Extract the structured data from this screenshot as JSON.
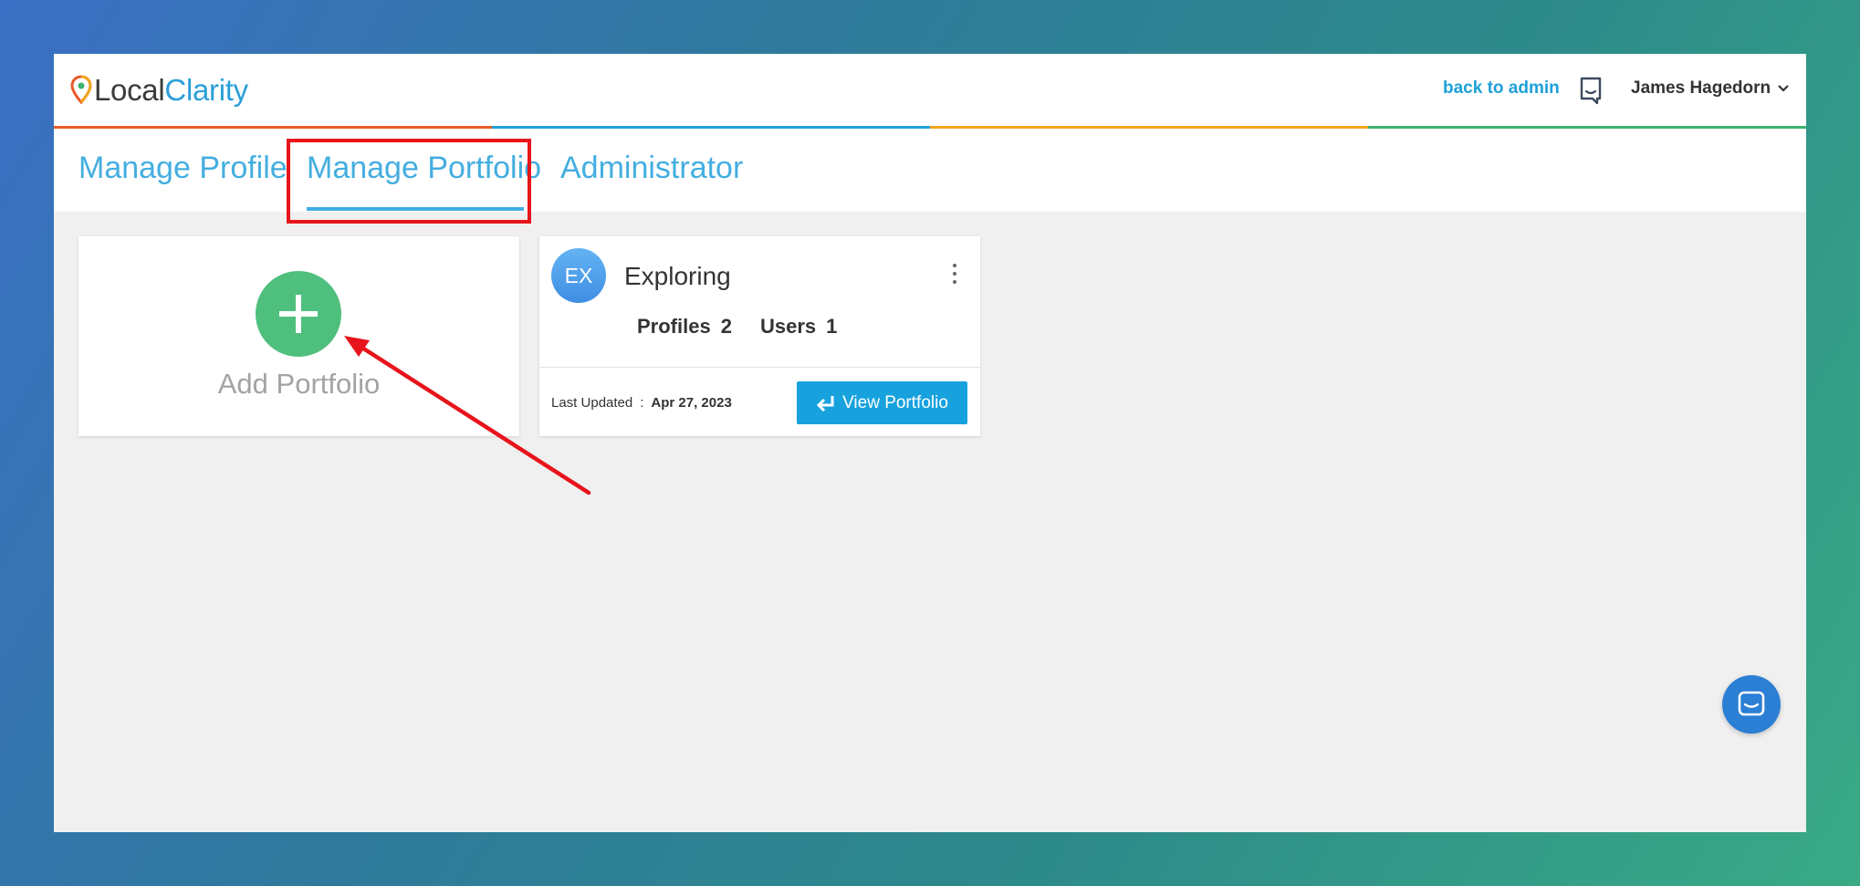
{
  "brand": {
    "name_part1": "Local",
    "name_part2": "Clarity",
    "colors": {
      "dark": "#3a3a3a",
      "accent": "#2b9fd8",
      "orange": "#ea5a2b",
      "blue": "#1ea1d9",
      "yellow": "#f2a51f",
      "green": "#3cb46d"
    }
  },
  "header": {
    "back_to_admin": "back to admin",
    "user_name": "James Hagedorn",
    "icons": [
      "chat-bubble-icon",
      "chevron-down-icon"
    ]
  },
  "tabs": [
    {
      "label": "Manage Profile",
      "active": false
    },
    {
      "label": "Manage Portfolio",
      "active": true
    },
    {
      "label": "Administrator",
      "active": false
    }
  ],
  "add_card": {
    "label": "Add Portfolio",
    "icon": "plus-icon"
  },
  "portfolio": {
    "initials": "EX",
    "name": "Exploring",
    "profiles_label": "Profiles",
    "profiles_value": "2",
    "users_label": "Users",
    "users_value": "1",
    "last_updated_label": "Last Updated",
    "last_updated_sep": ":",
    "last_updated_date": "Apr 27, 2023",
    "view_button": "View Portfolio",
    "icons": [
      "kebab-menu-icon",
      "enter-arrow-icon"
    ]
  },
  "annotation": {
    "highlight_color": "#e8141b"
  },
  "chat_widget": {
    "icon": "chat-widget-icon"
  }
}
